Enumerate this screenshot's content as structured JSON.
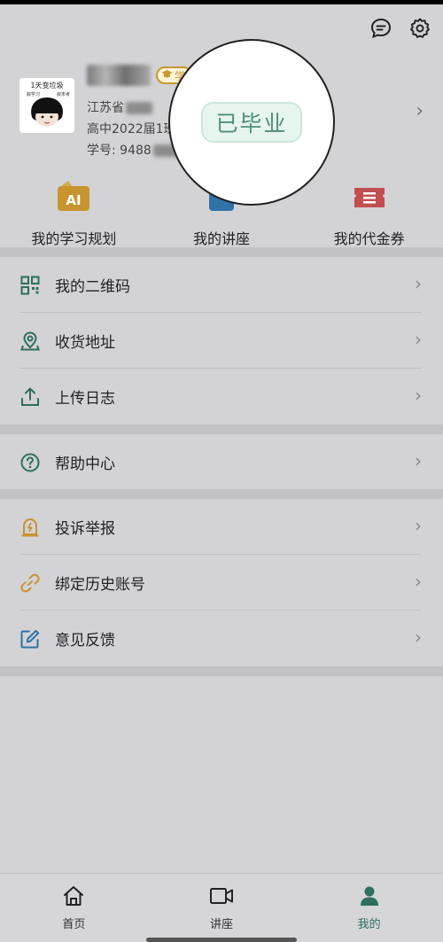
{
  "header": {
    "message_icon": "chat-bubble-icon",
    "settings_icon": "gear-icon"
  },
  "profile": {
    "badge_label": "学",
    "location": "江苏省",
    "class_line": "高中2022届1班",
    "student_id_prefix": "学号: 9488",
    "chevron": "›",
    "avatar_caption_top": "1天变垃圾",
    "avatar_caption_left": "叙学习",
    "avatar_caption_right": "叙末考"
  },
  "magnifier": {
    "graduation_tag": "已毕业"
  },
  "shortcuts": [
    {
      "label": "我的学习规划",
      "icon": "ai-plan-icon",
      "icon_text": "AI"
    },
    {
      "label": "我的讲座",
      "icon": "lecture-icon"
    },
    {
      "label": "我的代金券",
      "icon": "voucher-icon"
    }
  ],
  "menu": {
    "group1": [
      {
        "label": "我的二维码",
        "icon": "qr-code-icon"
      },
      {
        "label": "收货地址",
        "icon": "location-pin-icon"
      },
      {
        "label": "上传日志",
        "icon": "upload-icon"
      }
    ],
    "group2": [
      {
        "label": "帮助中心",
        "icon": "help-circle-icon"
      }
    ],
    "group3": [
      {
        "label": "投诉举报",
        "icon": "alarm-icon"
      },
      {
        "label": "绑定历史账号",
        "icon": "link-icon"
      },
      {
        "label": "意见反馈",
        "icon": "edit-icon"
      }
    ],
    "chevron": "›"
  },
  "nav": [
    {
      "label": "首页",
      "icon": "home-icon"
    },
    {
      "label": "讲座",
      "icon": "video-camera-icon"
    },
    {
      "label": "我的",
      "icon": "person-icon",
      "active": true
    }
  ],
  "colors": {
    "accent": "#2d6f60",
    "background": "#d3d2d5",
    "badge_gold": "#c69a2e"
  }
}
